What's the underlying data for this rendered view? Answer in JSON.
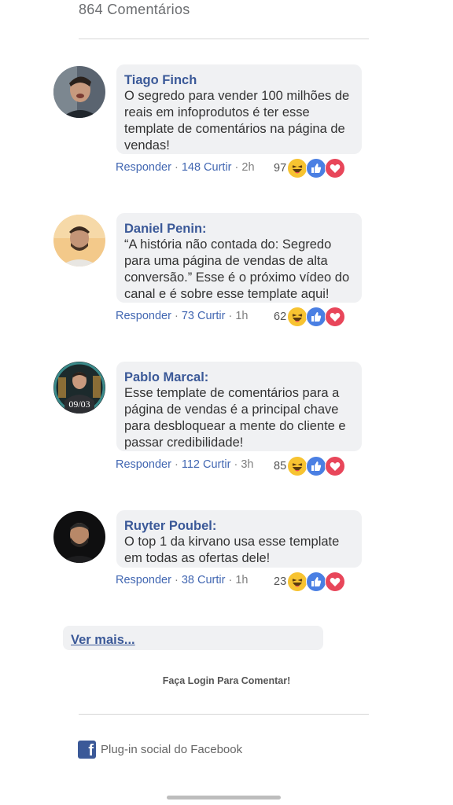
{
  "header": {
    "count_label": "864 Comentários"
  },
  "comments": [
    {
      "author": "Tiago Finch",
      "text": "O  segredo para vender 100 milhões de reais em infoprodutos é ter esse template de comentários na página de vendas!",
      "reply_label": "Responder",
      "sep": " · ",
      "likes_label": "148 Curtir",
      "time": "2h",
      "reaction_count": "97"
    },
    {
      "author": "Daniel Penin:",
      "text": "“A história não contada do: Segredo para uma página de vendas de alta conversão.” Esse é o próximo vídeo do canal e é sobre esse template aqui!",
      "reply_label": "Responder",
      "sep": " · ",
      "likes_label": "73 Curtir",
      "time": "1h",
      "reaction_count": "62"
    },
    {
      "author": "Pablo Marcal:",
      "text": "Esse template de comentários para a página de vendas é a principal chave para desbloquear a mente do cliente e passar credibilidade!",
      "reply_label": "Responder",
      "sep": " · ",
      "likes_label": "112 Curtir",
      "time": "3h",
      "reaction_count": "85",
      "avatar_text": "09/03"
    },
    {
      "author": "Ruyter Poubel:",
      "text": "O top 1 da kirvano usa esse template em todas as ofertas dele!",
      "reply_label": "Responder",
      "sep": " · ",
      "likes_label": "38 Curtir",
      "time": "1h",
      "reaction_count": "23"
    }
  ],
  "icons": {
    "reaction_haha": "laughing-face-icon",
    "reaction_like": "thumbs-up-icon",
    "reaction_love": "heart-icon",
    "facebook": "facebook-logo-icon"
  },
  "colors": {
    "author": "#3b5998",
    "link": "#4267b2",
    "bubble": "#f0f1f3",
    "haha": "#f7c331",
    "like": "#4a7fe3",
    "love": "#e8465a"
  },
  "footer": {
    "see_more_label": "Ver mais...",
    "login_label": "Faça Login Para Comentar!",
    "plugin_label": "Plug-in social do Facebook",
    "fb_glyph": "f"
  }
}
